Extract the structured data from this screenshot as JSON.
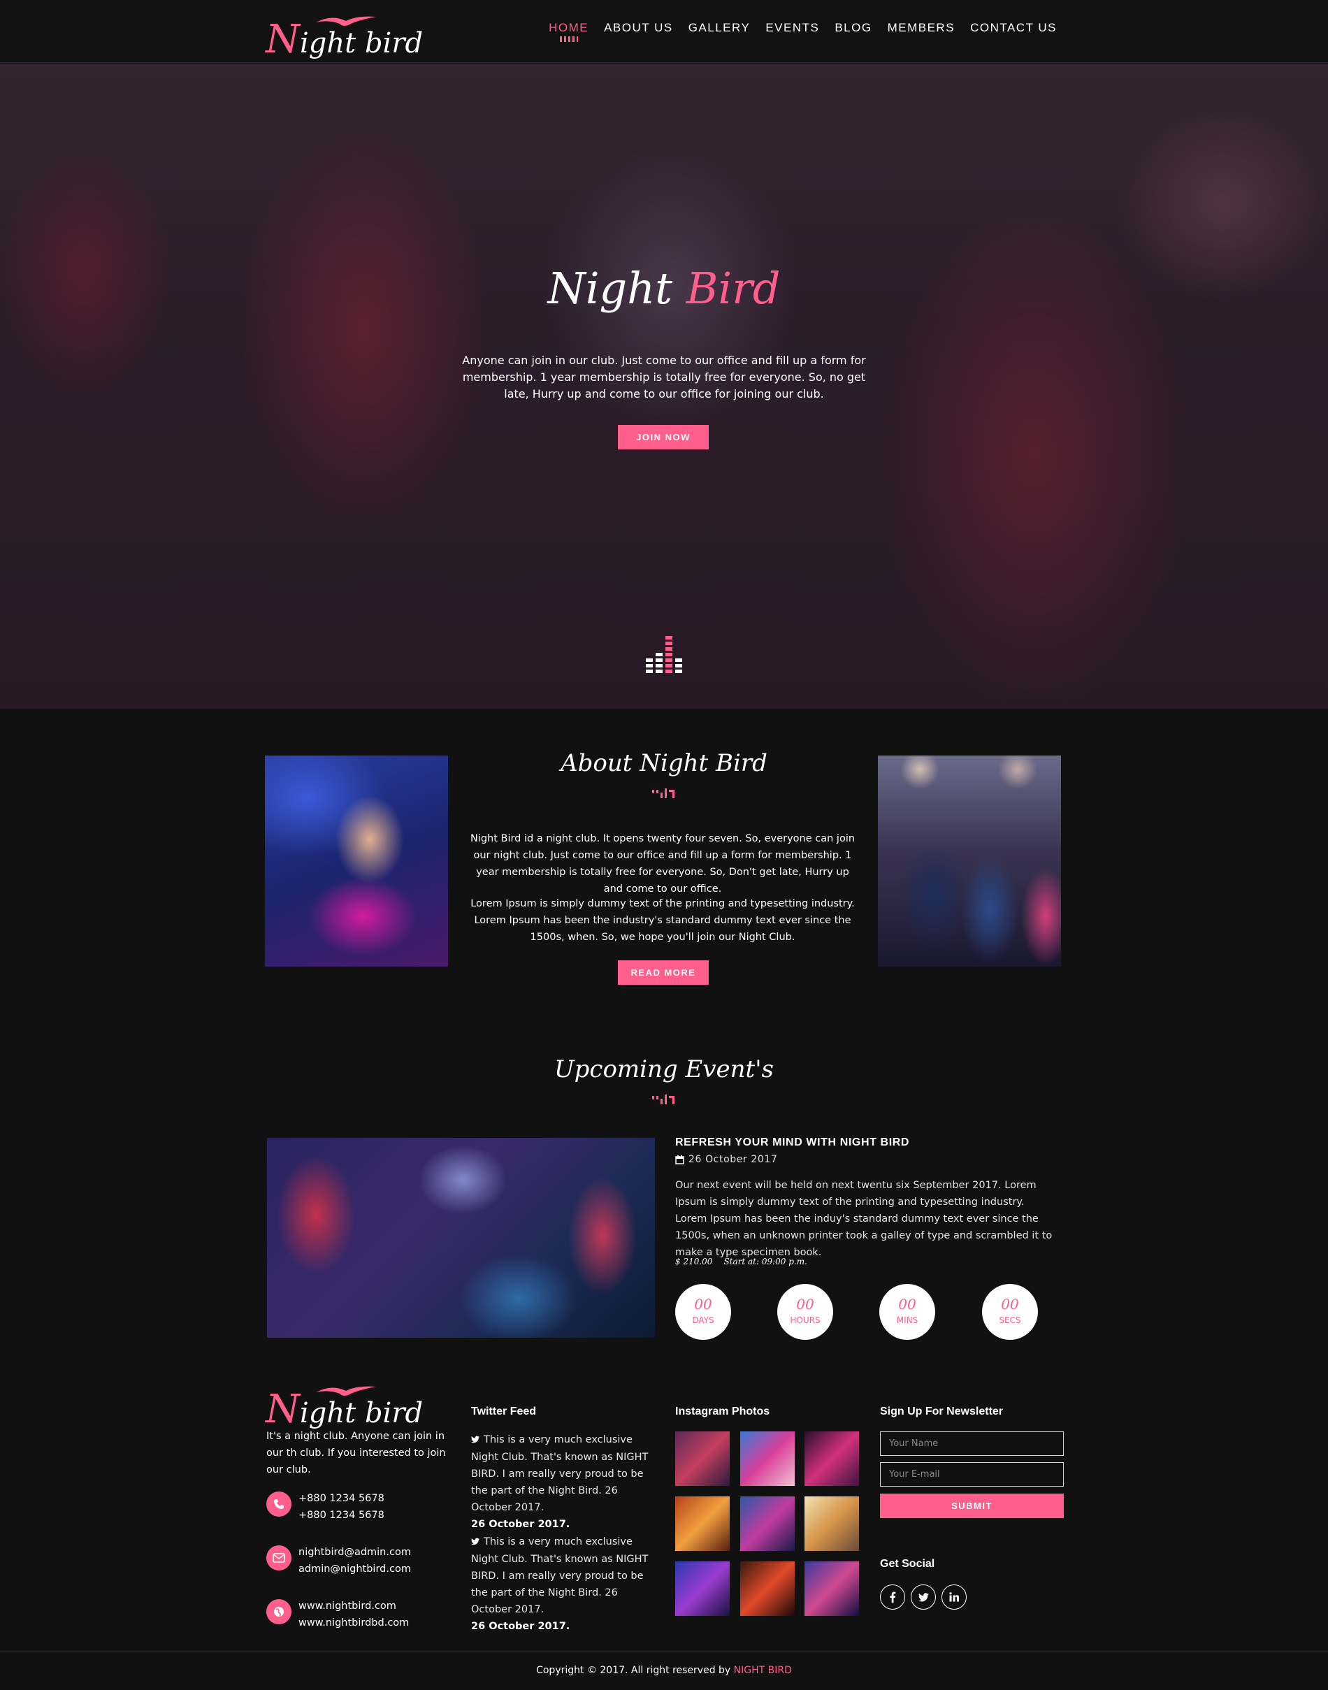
{
  "brand": {
    "logo_first": "N",
    "logo_rest": "ight bird",
    "accent_color": "#ff5f8a",
    "bird_icon": "bird-icon"
  },
  "nav": {
    "items": [
      "HOME",
      "ABOUT US",
      "GALLERY",
      "EVENTS",
      "BLOG",
      "MEMBERS",
      "CONTACT US"
    ],
    "active": "HOME"
  },
  "hero": {
    "title_first": "Night",
    "title_accent": "Bird",
    "text": "Anyone can join in our club. Just come to our office and fill up a form for membership. 1 year membership is totally free for everyone. So, no get late, Hurry up and come to our office for joining our club.",
    "button": "JOIN NOW",
    "scroll_icon": "equalizer-icon"
  },
  "about": {
    "title": "About Night Bird",
    "paragraph1": "Night Bird id a night club. It opens twenty four seven. So, everyone can join our night club. Just come to our office and fill up a form for membership. 1 year membership is totally free for everyone. So, Don't get late, Hurry up and come to our office.",
    "paragraph2": "Lorem Ipsum is simply dummy text of the printing and typesetting industry. Lorem Ipsum has been the industry's standard dummy text ever since the 1500s, when. So, we hope you'll join our Night Club.",
    "button": "READ MORE"
  },
  "events": {
    "title": "Upcoming Event's",
    "event_title": "REFRESH YOUR MIND WITH NIGHT BIRD",
    "date": "26 October 2017",
    "description": "Our next event will be held on next twentu six September 2017. Lorem Ipsum is simply dummy text of the printing and typesetting industry. Lorem Ipsum has been the induy's standard dummy text ever since the 1500s, when an unknown printer took a galley of type and scrambled it to make a type specimen book.",
    "price": "$ 210.00",
    "start": "Start at: 09:00 p.m.",
    "countdown": [
      {
        "num": "00",
        "unit": "DAYS"
      },
      {
        "num": "00",
        "unit": "HOURS"
      },
      {
        "num": "00",
        "unit": "MINS"
      },
      {
        "num": "00",
        "unit": "SECS"
      }
    ]
  },
  "footer": {
    "about": "It's a night club. Anyone can join in our th club. If you interested to join our club.",
    "phone": [
      "+880 1234 5678",
      "+880 1234 5678"
    ],
    "email": [
      "nightbird@admin.com",
      "admin@nightbird.com"
    ],
    "web": [
      "www.nightbird.com",
      "www.nightbirdbd.com"
    ],
    "twitter_heading": "Twitter Feed",
    "tweets": [
      {
        "text": "This is a very much exclusive Night Club. That's known as NIGHT BIRD. I am really very proud to be the part of the Night Bird. 26 October 2017.",
        "date": "26 October 2017."
      },
      {
        "text": "This is a very much exclusive Night Club. That's known as NIGHT BIRD. I am really very proud to be the part of the Night Bird. 26 October 2017.",
        "date": "26 October 2017."
      }
    ],
    "instagram_heading": "Instagram Photos",
    "newsletter_heading": "Sign Up For Newsletter",
    "name_placeholder": "Your Name",
    "email_placeholder": "Your E-mail",
    "submit": "SUBMIT",
    "social_heading": "Get Social",
    "social_icons": [
      "facebook-icon",
      "twitter-icon",
      "linkedin-icon"
    ]
  },
  "copyright": {
    "text": "Copyright © 2017. All right reserved by",
    "brand": "NIGHT BIRD"
  }
}
